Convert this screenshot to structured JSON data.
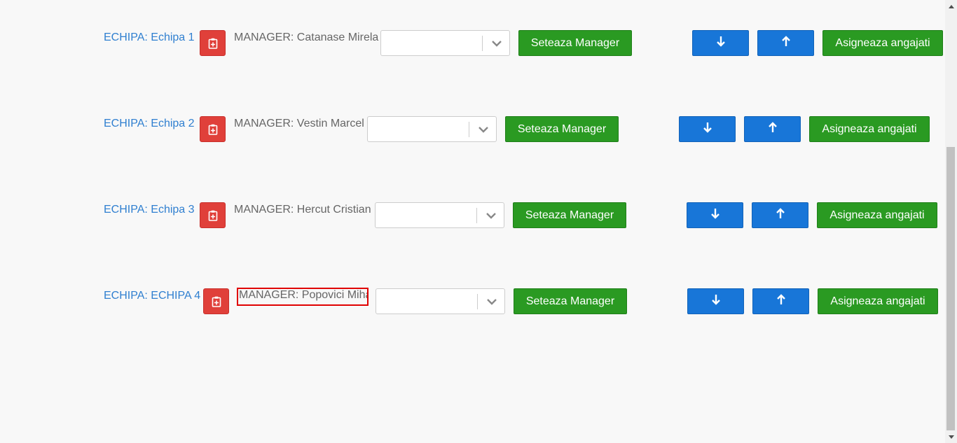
{
  "teams": [
    {
      "team_label": "ECHIPA: Echipa 1",
      "manager_label": "MANAGER: Catanase Mirela",
      "select_value": "",
      "set_manager_label": "Seteaza Manager",
      "assign_label": "Asigneaza angajati"
    },
    {
      "team_label": "ECHIPA: Echipa 2",
      "manager_label": "MANAGER: Vestin Marcel",
      "select_value": "",
      "set_manager_label": "Seteaza Manager",
      "assign_label": "Asigneaza angajati"
    },
    {
      "team_label": "ECHIPA: Echipa 3",
      "manager_label": "MANAGER: Hercut Cristian",
      "select_value": "",
      "set_manager_label": "Seteaza Manager",
      "assign_label": "Asigneaza angajati"
    },
    {
      "team_label": "ECHIPA: ECHIPA 4",
      "manager_label": "MANAGER: Popovici Mihai",
      "select_value": "",
      "set_manager_label": "Seteaza Manager",
      "assign_label": "Asigneaza angajati"
    }
  ],
  "icons": {
    "delete": "clipboard-plus-icon",
    "move_down": "arrow-down-icon",
    "move_up": "arrow-up-icon",
    "dropdown": "chevron-down-icon"
  },
  "colors": {
    "link": "#2f7fd0",
    "danger": "#e0403a",
    "success": "#2a9a22",
    "primary": "#1876d8",
    "highlight": "#e00000"
  }
}
